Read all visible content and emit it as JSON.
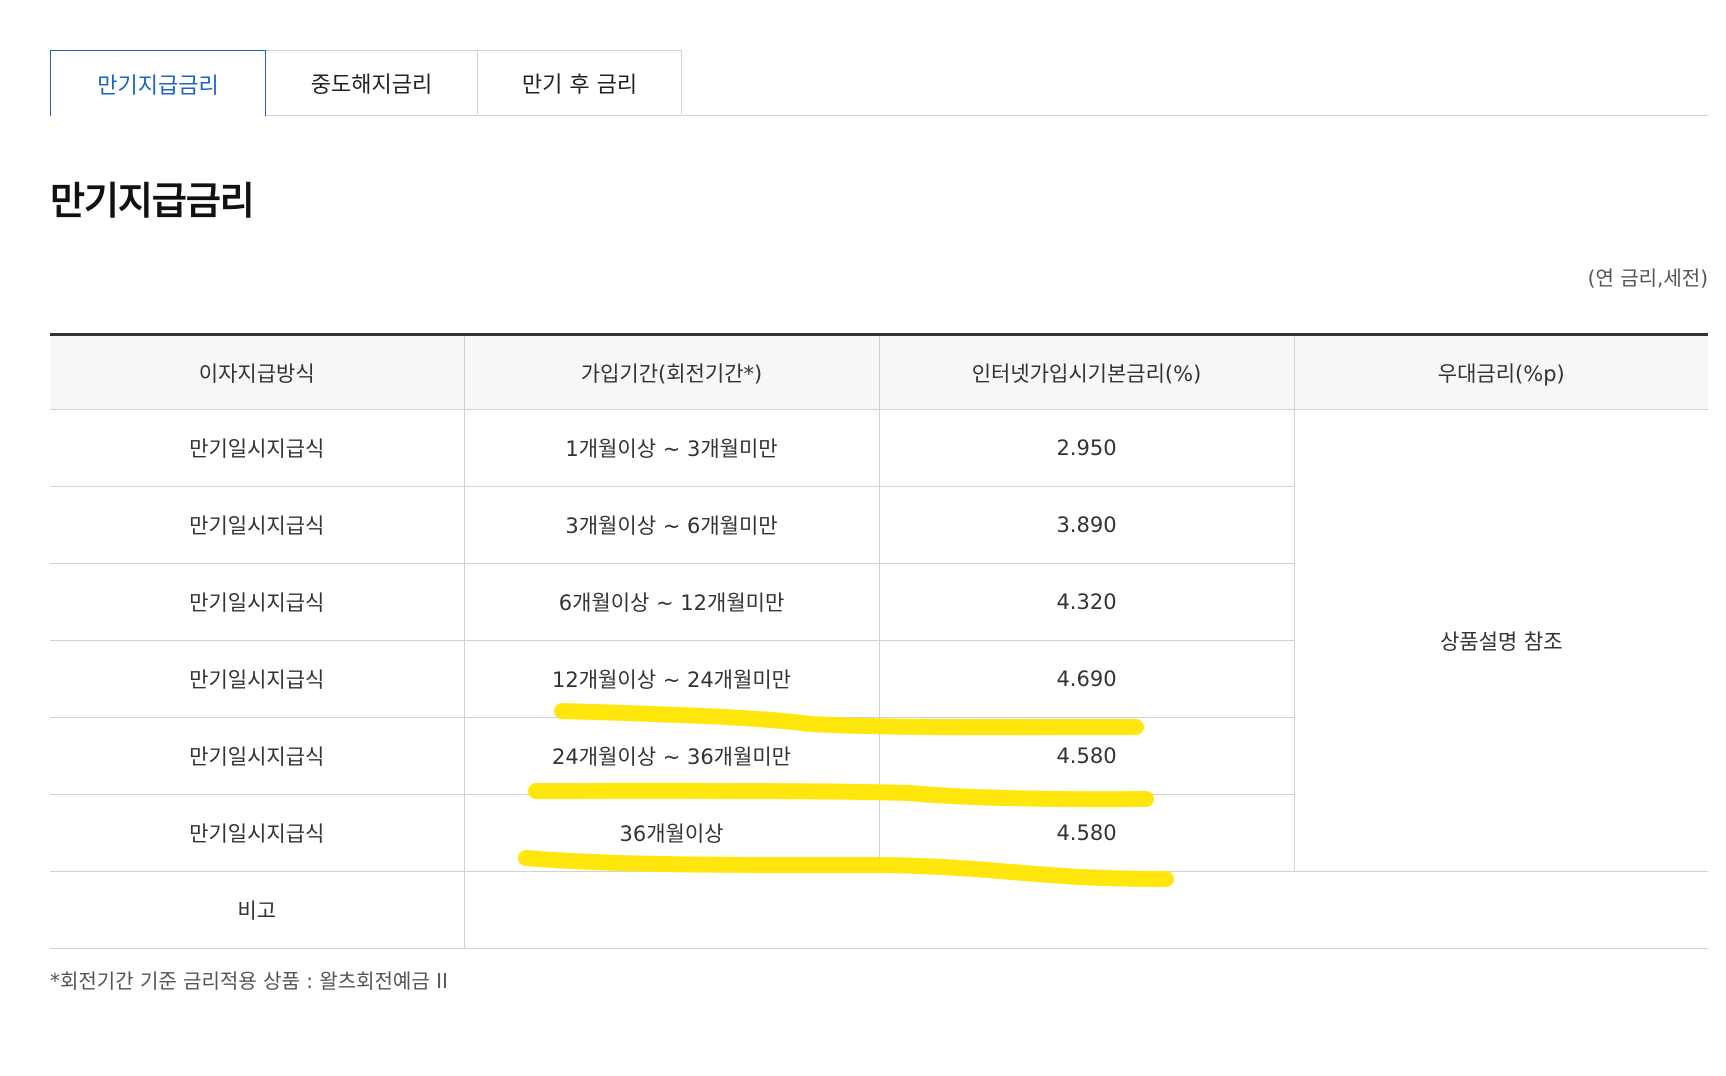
{
  "tabs": [
    {
      "label": "만기지급금리",
      "active": true
    },
    {
      "label": "중도해지금리",
      "active": false
    },
    {
      "label": "만기 후 금리",
      "active": false
    }
  ],
  "section_title": "만기지급금리",
  "unit_note": "(연 금리,세전)",
  "table": {
    "headers": [
      "이자지급방식",
      "가입기간(회전기간*)",
      "인터넷가입시기본금리(%)",
      "우대금리(%p)"
    ],
    "rows": [
      {
        "method": "만기일시지급식",
        "period": "1개월이상 ~ 3개월미만",
        "rate": "2.950"
      },
      {
        "method": "만기일시지급식",
        "period": "3개월이상 ~ 6개월미만",
        "rate": "3.890"
      },
      {
        "method": "만기일시지급식",
        "period": "6개월이상 ~ 12개월미만",
        "rate": "4.320"
      },
      {
        "method": "만기일시지급식",
        "period": "12개월이상 ~ 24개월미만",
        "rate": "4.690"
      },
      {
        "method": "만기일시지급식",
        "period": "24개월이상 ~ 36개월미만",
        "rate": "4.580"
      },
      {
        "method": "만기일시지급식",
        "period": "36개월이상",
        "rate": "4.580"
      }
    ],
    "preferential_rate_note": "상품설명 참조",
    "remarks_label": "비고",
    "remarks_value": ""
  },
  "footnote": "*회전기간 기준 금리적용 상품 : 왈츠회전예금 II",
  "highlight_color": "#ffe600"
}
